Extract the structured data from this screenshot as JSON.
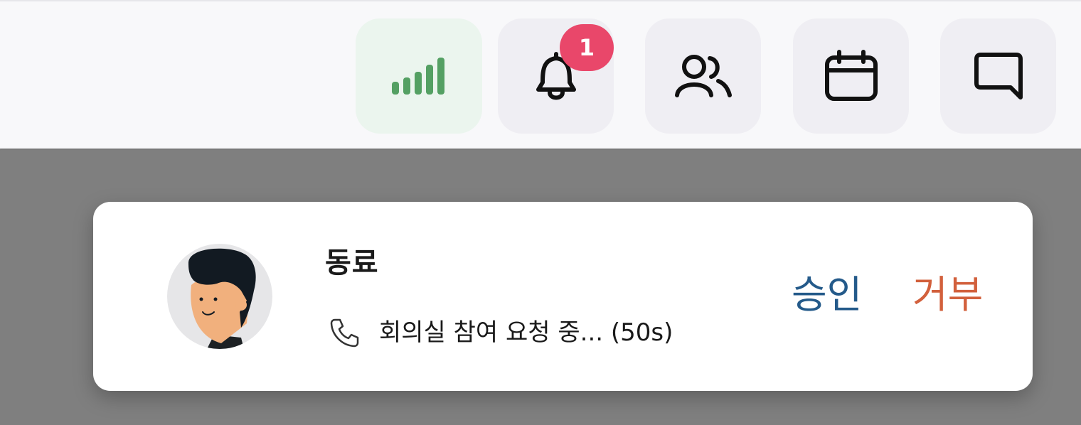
{
  "topbar": {
    "icons": {
      "signal": "signal-strength-icon",
      "bell": "bell-icon",
      "people": "people-icon",
      "calendar": "calendar-icon",
      "chat": "chat-icon"
    },
    "notification_count": "1",
    "colors": {
      "signal": "#54a063",
      "badge": "#e9476a"
    }
  },
  "call_request": {
    "caller_name": "동료",
    "status_icon": "phone-icon",
    "status_text": "회의실 참여 요청 중... (50s)",
    "approve_label": "승인",
    "reject_label": "거부",
    "colors": {
      "approve": "#245a8a",
      "reject": "#d2603c"
    }
  }
}
